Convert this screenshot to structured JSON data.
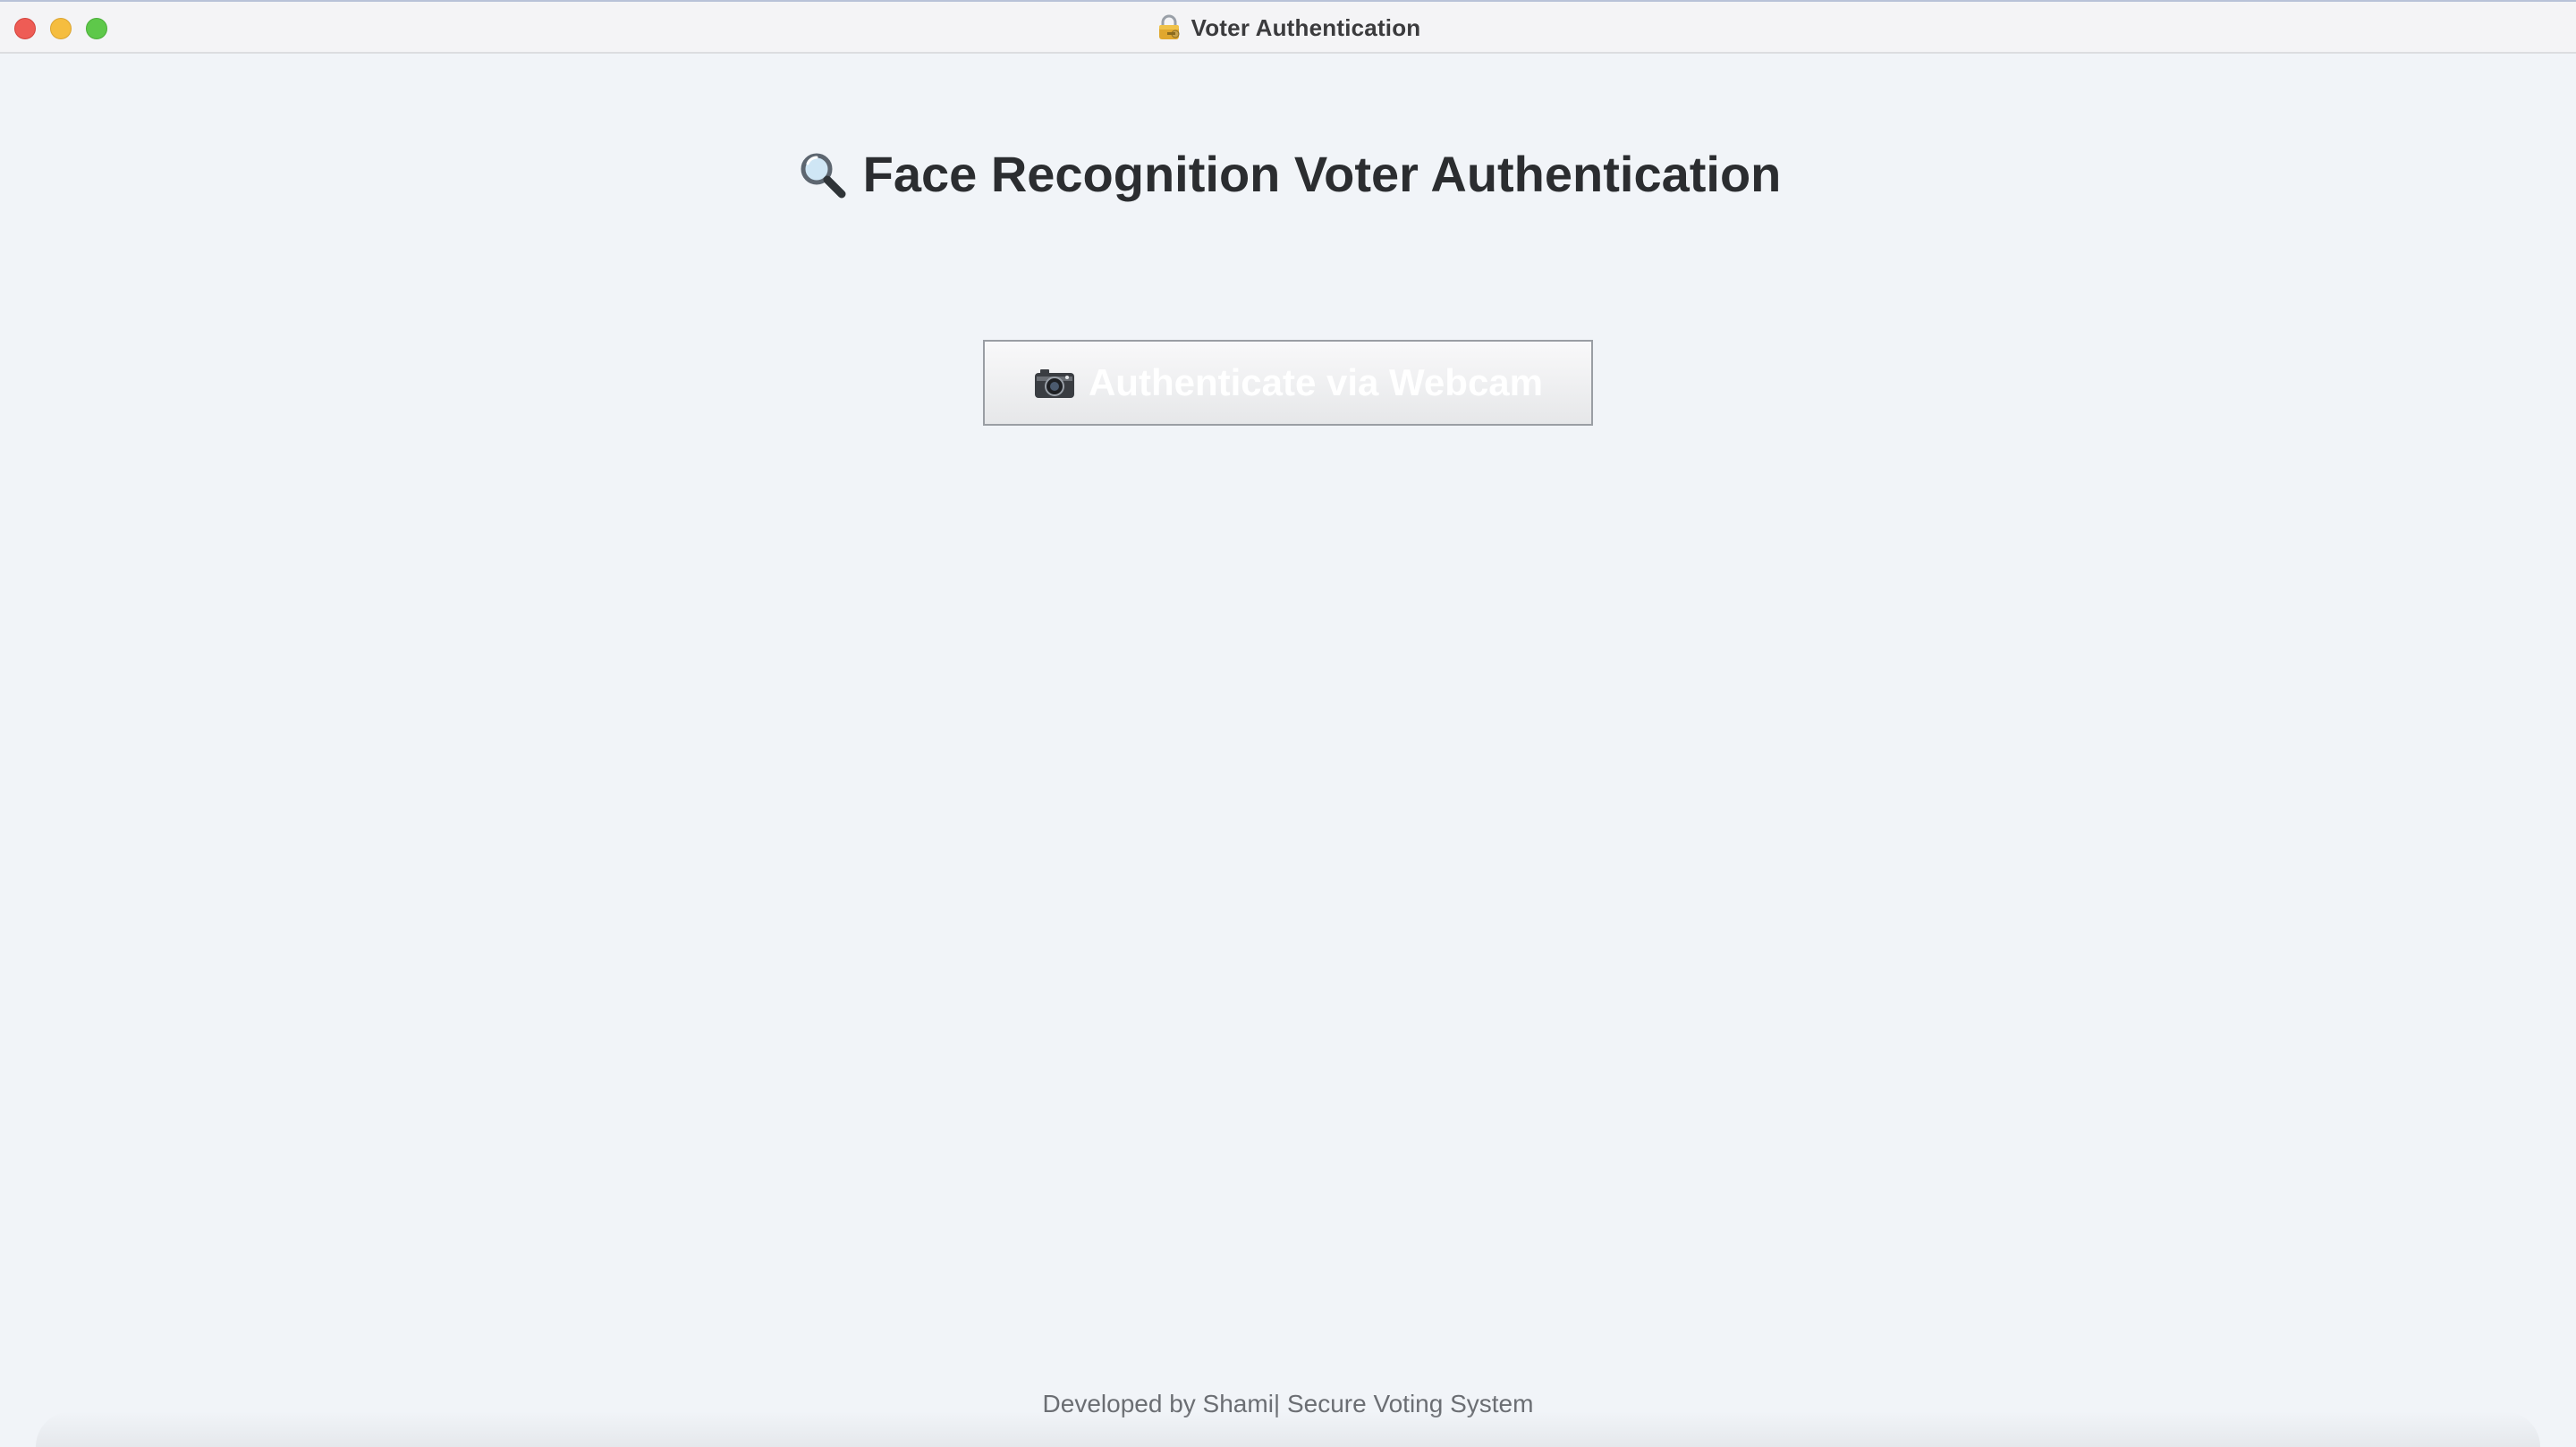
{
  "window": {
    "title": "Voter Authentication",
    "title_icon": "lock-with-key-icon"
  },
  "main": {
    "heading": "Face Recognition Voter Authentication",
    "heading_icon": "magnifying-glass-icon",
    "auth_button": {
      "label": "Authenticate via Webcam",
      "icon": "camera-icon"
    }
  },
  "footer": {
    "text": "Developed by Shami| Secure Voting System"
  },
  "colors": {
    "background": "#f1f4f8",
    "heading": "#2b2d30",
    "button_label": "#ffffff",
    "footer": "#6b6e73"
  }
}
